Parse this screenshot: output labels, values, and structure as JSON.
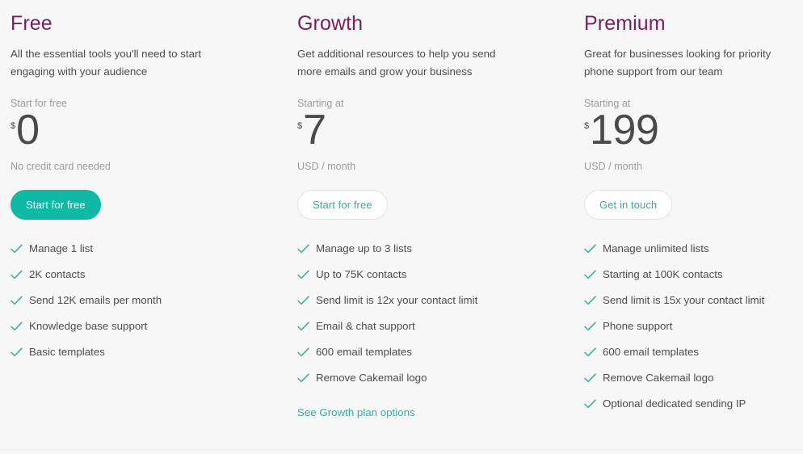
{
  "page": {
    "background_color": "#f7f7f7",
    "heading_color": "#7b1f5c",
    "accent_color": "#0fb9a4",
    "link_color": "#3aab9c",
    "body_text_color": "#4d4d4d",
    "muted_text_color": "#9b9b9b"
  },
  "plans": [
    {
      "name": "Free",
      "description": "All the essential tools you'll need to start engaging with your audience",
      "price_label": "Start for free",
      "currency_symbol": "$",
      "price_amount": "0",
      "price_note": "No credit card needed",
      "cta_label": "Start for free",
      "cta_style": "primary",
      "features": [
        "Manage 1 list",
        "2K contacts",
        "Send 12K emails per month",
        "Knowledge base support",
        "Basic templates"
      ],
      "link_label": ""
    },
    {
      "name": "Growth",
      "description": "Get additional resources to help you send more emails and grow your business",
      "price_label": "Starting at",
      "currency_symbol": "$",
      "price_amount": "7",
      "price_note": "USD / month",
      "cta_label": "Start for free",
      "cta_style": "outline",
      "features": [
        "Manage up to 3 lists",
        "Up to 75K contacts",
        "Send limit is 12x your contact limit",
        "Email & chat support",
        "600 email templates",
        "Remove Cakemail logo"
      ],
      "link_label": "See Growth plan options"
    },
    {
      "name": "Premium",
      "description": "Great for businesses looking for priority phone support from our team",
      "price_label": "Starting at",
      "currency_symbol": "$",
      "price_amount": "199",
      "price_note": "USD / month",
      "cta_label": "Get in touch",
      "cta_style": "outline",
      "features": [
        "Manage unlimited lists",
        "Starting at 100K contacts",
        "Send limit is 15x your contact limit",
        "Phone support",
        "600 email templates",
        "Remove Cakemail logo",
        "Optional dedicated sending IP"
      ],
      "link_label": ""
    }
  ],
  "icons": {
    "check": "check-icon"
  }
}
